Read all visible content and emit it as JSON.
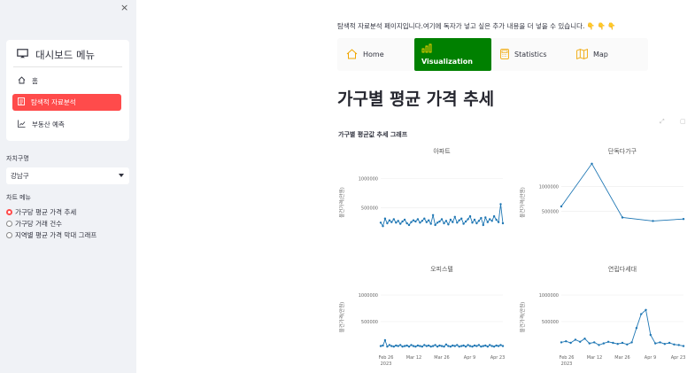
{
  "sidebar": {
    "close_glyph": "×",
    "menu_title": "대시보드 메뉴",
    "menu_items": [
      {
        "label": "홈",
        "icon": "home-icon"
      },
      {
        "label": "탐색적 자료분석",
        "icon": "document-icon",
        "active": true
      },
      {
        "label": "부동산 예측",
        "icon": "trend-chart-icon"
      }
    ],
    "district_label": "자치구명",
    "district_value": "강남구",
    "chart_menu_label": "차트 메뉴",
    "chart_options": [
      {
        "label": "가구당 평균 가격 추세",
        "selected": true
      },
      {
        "label": "가구당 거래 건수",
        "selected": false
      },
      {
        "label": "지역별 평균 가격 막대 그래프",
        "selected": false
      }
    ]
  },
  "main": {
    "intro": "탐색적 자료분석 페이지입니다.여기에 독자가 넣고 싶은 추가 내용을 더 넣을 수 있습니다. 👇 👇 👇",
    "tabs": [
      {
        "label": "Home",
        "icon": "house-icon"
      },
      {
        "label": "Visualization",
        "icon": "bar-chart-icon",
        "active": true
      },
      {
        "label": "Statistics",
        "icon": "calculator-icon"
      },
      {
        "label": "Map",
        "icon": "map-icon"
      }
    ],
    "title": "가구별 평균 가격 추세",
    "figure_title": "가구별 평균값 추세 그래프"
  },
  "colors": {
    "accent": "#ff4b4b",
    "active_tab": "#008000",
    "line": "#1f77b4"
  },
  "chart_data": [
    {
      "type": "line",
      "title": "아파트",
      "ylabel": "물건가격(만원)",
      "yticks": [
        "1000000",
        "500000"
      ],
      "xticks": [],
      "ylim": [
        0,
        1300000
      ],
      "x": [
        0,
        1,
        2,
        3,
        4,
        5,
        6,
        7,
        8,
        9,
        10,
        11,
        12,
        13,
        14,
        15,
        16,
        17,
        18,
        19,
        20,
        21,
        22,
        23,
        24,
        25,
        26,
        27,
        28,
        29,
        30,
        31,
        32,
        33,
        34,
        35,
        36,
        37,
        38,
        39,
        40,
        41,
        42,
        43,
        44,
        45,
        46,
        47,
        48,
        49,
        50,
        51,
        52,
        53,
        54,
        55,
        56
      ],
      "y": [
        240000,
        180000,
        310000,
        230000,
        280000,
        250000,
        300000,
        240000,
        270000,
        220000,
        260000,
        290000,
        230000,
        200000,
        250000,
        280000,
        260000,
        300000,
        240000,
        270000,
        310000,
        250000,
        280000,
        220000,
        370000,
        200000,
        240000,
        260000,
        300000,
        230000,
        270000,
        210000,
        290000,
        250000,
        340000,
        240000,
        280000,
        310000,
        220000,
        260000,
        300000,
        350000,
        240000,
        290000,
        230000,
        270000,
        320000,
        200000,
        330000,
        250000,
        300000,
        270000,
        350000,
        290000,
        250000,
        560000,
        230000
      ]
    },
    {
      "type": "line",
      "title": "단독다가구",
      "ylabel": "물건가격(만원)",
      "yticks": [
        "1000000",
        "500000"
      ],
      "xticks": [],
      "ylim": [
        0,
        1500000
      ],
      "x": [
        0,
        1,
        2,
        3,
        4
      ],
      "y": [
        600000,
        1450000,
        380000,
        310000,
        350000
      ]
    },
    {
      "type": "line",
      "title": "오피스텔",
      "ylabel": "물건가격(만원)",
      "yticks": [
        "1000000",
        "500000"
      ],
      "xticks": [
        "Feb 26",
        "Mar 12",
        "Mar 26",
        "Apr 9",
        "Apr 23"
      ],
      "xsub": "2023",
      "ylim": [
        0,
        1300000
      ],
      "x": [
        0,
        1,
        2,
        3,
        4,
        5,
        6,
        7,
        8,
        9,
        10,
        11,
        12,
        13,
        14,
        15,
        16,
        17,
        18,
        19,
        20,
        21,
        22,
        23,
        24,
        25,
        26,
        27,
        28,
        29,
        30,
        31,
        32,
        33,
        34,
        35,
        36,
        37,
        38,
        39,
        40,
        41,
        42,
        43,
        44,
        45,
        46,
        47,
        48,
        49,
        50,
        51,
        52,
        53,
        54,
        55,
        56
      ],
      "y": [
        40000,
        50000,
        150000,
        30000,
        60000,
        40000,
        30000,
        50000,
        40000,
        60000,
        30000,
        40000,
        50000,
        30000,
        60000,
        40000,
        30000,
        50000,
        40000,
        30000,
        60000,
        40000,
        50000,
        30000,
        40000,
        60000,
        30000,
        50000,
        40000,
        30000,
        70000,
        40000,
        30000,
        50000,
        40000,
        60000,
        30000,
        40000,
        50000,
        30000,
        60000,
        40000,
        30000,
        50000,
        40000,
        60000,
        30000,
        40000,
        50000,
        30000,
        60000,
        40000,
        30000,
        50000,
        40000,
        60000,
        40000
      ]
    },
    {
      "type": "line",
      "title": "연립다세대",
      "ylabel": "물건가격(만원)",
      "yticks": [
        "1000000",
        "500000"
      ],
      "xticks": [
        "Feb 26",
        "Mar 12",
        "Mar 26",
        "Apr 9",
        "Apr 23"
      ],
      "xsub": "2023",
      "ylim": [
        0,
        1300000
      ],
      "x": [
        0,
        1,
        2,
        3,
        4,
        5,
        6,
        7,
        8,
        9,
        10,
        11,
        12,
        13,
        14,
        15,
        16,
        17,
        18,
        19,
        20,
        21,
        22,
        23,
        24,
        25,
        26
      ],
      "y": [
        110000,
        130000,
        100000,
        160000,
        120000,
        180000,
        90000,
        110000,
        60000,
        90000,
        120000,
        100000,
        80000,
        100000,
        70000,
        110000,
        380000,
        640000,
        720000,
        250000,
        90000,
        110000,
        80000,
        100000,
        70000,
        60000,
        40000
      ]
    }
  ]
}
